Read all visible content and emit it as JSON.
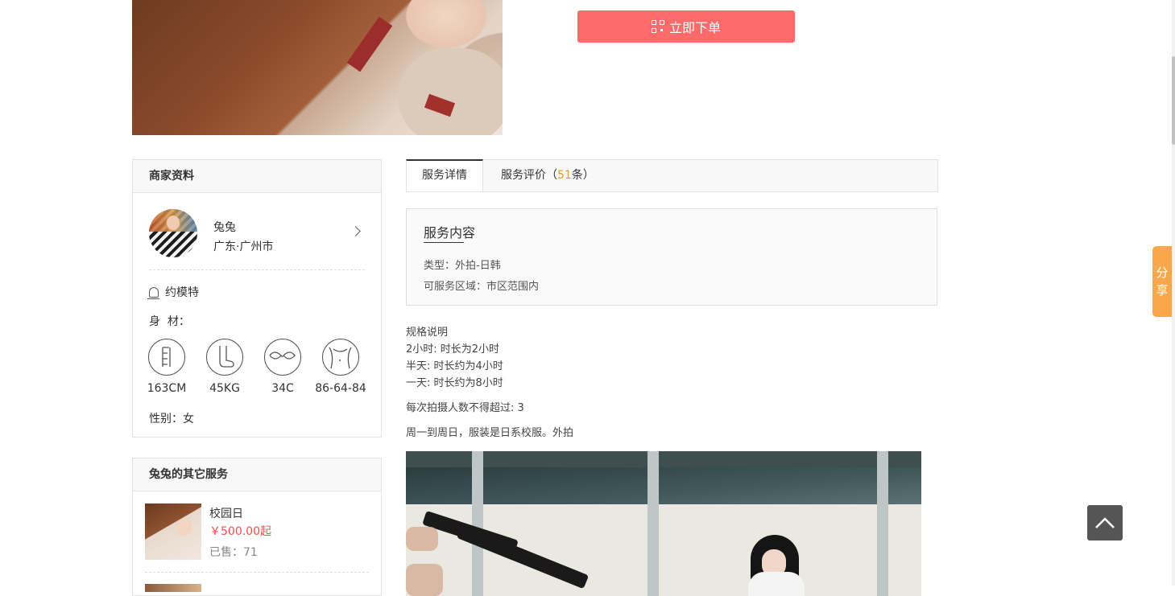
{
  "order": {
    "label": "立即下单",
    "icon": "qr-code-icon",
    "color": "#fd6a6a"
  },
  "share": {
    "label_top": "分",
    "label_bottom": "享",
    "color": "#f8a84a"
  },
  "merchant_panel": {
    "title": "商家资料",
    "name": "兔兔",
    "location": "广东·广州市",
    "book_model": "约模特",
    "body_label": "身  材：",
    "measurements": [
      {
        "icon": "height-icon",
        "value": "163CM"
      },
      {
        "icon": "weight-icon",
        "value": "45KG"
      },
      {
        "icon": "bra-icon",
        "value": "34C"
      },
      {
        "icon": "waist-icon",
        "value": "86-64-84"
      }
    ],
    "gender": "性别：女"
  },
  "other_services": {
    "title": "兔兔的其它服务",
    "items": [
      {
        "title": "校园日",
        "price": "￥500.00起",
        "sold": "已售：71"
      }
    ]
  },
  "tabs": {
    "details": "服务详情",
    "reviews_prefix": "服务评价（",
    "reviews_count": "51",
    "reviews_suffix": "条）"
  },
  "service_content": {
    "title": "服务内容",
    "type": "类型：外拍-日韩",
    "area": "可服务区域：市区范围内"
  },
  "description": {
    "spec_title": "规格说明",
    "spec_lines": [
      "2小时: 时长为2小时",
      "半天: 时长约为4小时",
      "一天: 时长约为8小时"
    ],
    "max_people": "每次拍摄人数不得超过: 3",
    "note": "周一到周日，服装是日系校服。外拍"
  }
}
